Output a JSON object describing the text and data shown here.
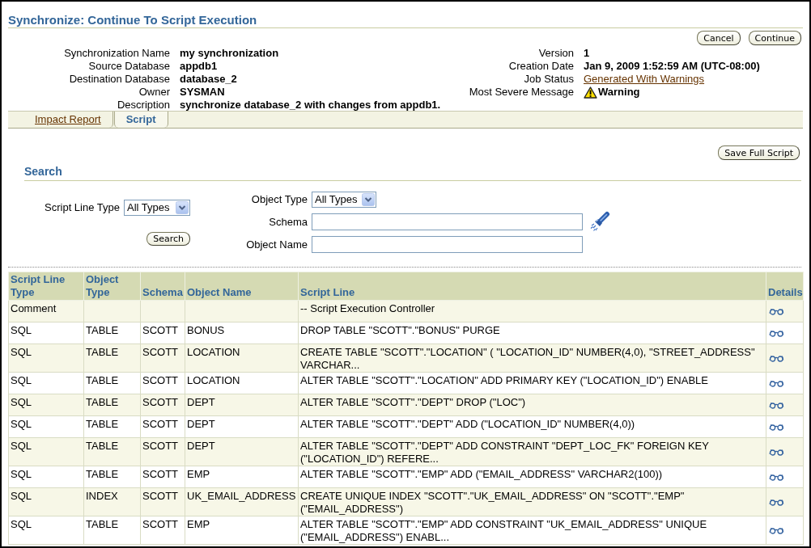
{
  "page": {
    "title": "Synchronize: Continue To Script Execution"
  },
  "actions": [
    {
      "label": "Cancel"
    },
    {
      "label": "Continue"
    }
  ],
  "summary": {
    "left": [
      {
        "label": "Synchronization Name",
        "value": "my synchronization"
      },
      {
        "label": "Source Database",
        "value": "appdb1"
      },
      {
        "label": "Destination Database",
        "value": "database_2"
      },
      {
        "label": "Owner",
        "value": "SYSMAN"
      },
      {
        "label": "Description",
        "value": "synchronize database_2 with changes from appdb1."
      }
    ],
    "right": [
      {
        "label": "Version",
        "value": "1",
        "kind": "text"
      },
      {
        "label": "Creation Date",
        "value": "Jan 9, 2009 1:52:59 AM (UTC-08:00)",
        "kind": "text"
      },
      {
        "label": "Job Status",
        "value": "Generated With Warnings",
        "kind": "link"
      },
      {
        "label": "Most Severe Message",
        "value": "Warning",
        "kind": "warning"
      }
    ]
  },
  "tabs": [
    {
      "label": "Impact Report",
      "selected": false
    },
    {
      "label": "Script",
      "selected": true
    }
  ],
  "toolbar": {
    "save_button": "Save Full Script"
  },
  "search": {
    "title": "Search",
    "script_line_type": {
      "label": "Script Line Type",
      "value": "All Types"
    },
    "object_type": {
      "label": "Object Type",
      "value": "All Types"
    },
    "schema": {
      "label": "Schema"
    },
    "object_name": {
      "label": "Object Name"
    },
    "button": "Search"
  },
  "table": {
    "columns": [
      "Script Line Type",
      "Object Type",
      "Schema",
      "Object Name",
      "Script Line",
      "Details"
    ],
    "rows": [
      {
        "script_line_type": "Comment",
        "script_line": "-- Script Execution Controller"
      },
      {
        "script_line_type": "SQL",
        "object_type": "TABLE",
        "schema": "SCOTT",
        "object_name": "BONUS",
        "script_line": "DROP TABLE \"SCOTT\".\"BONUS\" PURGE"
      },
      {
        "script_line_type": "SQL",
        "object_type": "TABLE",
        "schema": "SCOTT",
        "object_name": "LOCATION",
        "script_line": "CREATE TABLE \"SCOTT\".\"LOCATION\" ( \"LOCATION_ID\" NUMBER(4,0), \"STREET_ADDRESS\" VARCHAR..."
      },
      {
        "script_line_type": "SQL",
        "object_type": "TABLE",
        "schema": "SCOTT",
        "object_name": "LOCATION",
        "script_line": "ALTER TABLE \"SCOTT\".\"LOCATION\" ADD PRIMARY KEY (\"LOCATION_ID\") ENABLE"
      },
      {
        "script_line_type": "SQL",
        "object_type": "TABLE",
        "schema": "SCOTT",
        "object_name": "DEPT",
        "script_line": "ALTER TABLE \"SCOTT\".\"DEPT\" DROP (\"LOC\")"
      },
      {
        "script_line_type": "SQL",
        "object_type": "TABLE",
        "schema": "SCOTT",
        "object_name": "DEPT",
        "script_line": "ALTER TABLE \"SCOTT\".\"DEPT\" ADD (\"LOCATION_ID\" NUMBER(4,0))"
      },
      {
        "script_line_type": "SQL",
        "object_type": "TABLE",
        "schema": "SCOTT",
        "object_name": "DEPT",
        "script_line": "ALTER TABLE \"SCOTT\".\"DEPT\" ADD CONSTRAINT \"DEPT_LOC_FK\" FOREIGN KEY (\"LOCATION_ID\") REFERE..."
      },
      {
        "script_line_type": "SQL",
        "object_type": "TABLE",
        "schema": "SCOTT",
        "object_name": "EMP",
        "script_line": "ALTER TABLE \"SCOTT\".\"EMP\" ADD (\"EMAIL_ADDRESS\" VARCHAR2(100))"
      },
      {
        "script_line_type": "SQL",
        "object_type": "INDEX",
        "schema": "SCOTT",
        "object_name": "UK_EMAIL_ADDRESS",
        "script_line": "CREATE UNIQUE INDEX \"SCOTT\".\"UK_EMAIL_ADDRESS\" ON \"SCOTT\".\"EMP\" (\"EMAIL_ADDRESS\")"
      },
      {
        "script_line_type": "SQL",
        "object_type": "TABLE",
        "schema": "SCOTT",
        "object_name": "EMP",
        "script_line": "ALTER TABLE \"SCOTT\".\"EMP\" ADD CONSTRAINT \"UK_EMAIL_ADDRESS\" UNIQUE (\"EMAIL_ADDRESS\") ENABL..."
      }
    ]
  }
}
